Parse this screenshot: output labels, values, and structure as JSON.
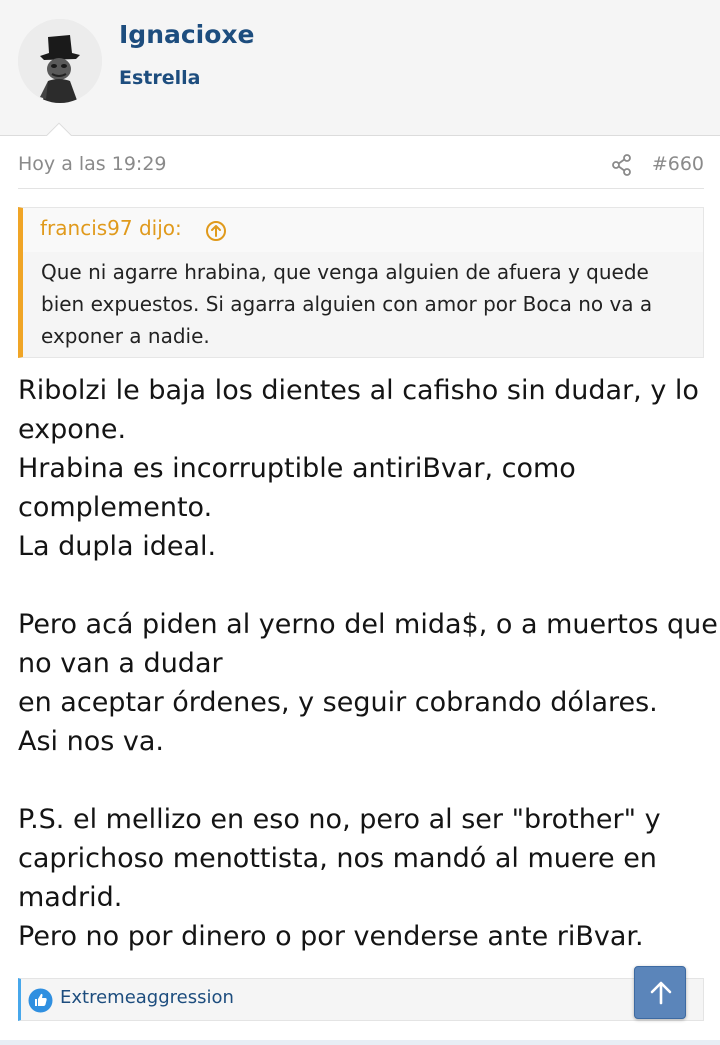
{
  "user": {
    "name": "Ignacioxe",
    "title": "Estrella",
    "avatar_icon": "top-hat-figure-avatar"
  },
  "post": {
    "date": "Hoy a las 19:29",
    "number": "#660",
    "share_icon": "share-icon",
    "quote": {
      "author": "francis97 dijo:",
      "up_icon": "arrow-up-circle-icon",
      "lines": [
        "Que ni agarre hrabina, que venga alguien de afuera y quede",
        "bien expuestos. Si agarra alguien con amor por Boca no va a",
        "exponer a nadie."
      ]
    },
    "body_lines": [
      "Ribolzi le baja los dientes al cafisho sin dudar, y lo",
      "expone.",
      "Hrabina es incorruptible antiriBvar, como",
      "complemento.",
      "La dupla ideal.",
      "",
      "Pero acá piden al yerno del mida$, o a muertos que",
      "no van a dudar",
      "en aceptar órdenes, y seguir cobrando dólares.",
      "Asi nos va.",
      "",
      "P.S. el mellizo en eso no, pero al ser \"brother\" y",
      "caprichoso menottista, nos mandó al muere en",
      "madrid.",
      "Pero no por dinero o por venderse ante riBvar."
    ],
    "reactions": {
      "icon": "like-icon",
      "user": "Extremeaggression"
    }
  },
  "scroll_top_icon": "arrow-up-icon",
  "colors": {
    "accent": "#1d4d7e",
    "quote_border": "#f0a526",
    "quote_author": "#e09a1c",
    "like": "#2f8fe0",
    "scroll_button": "#5b85ba"
  }
}
